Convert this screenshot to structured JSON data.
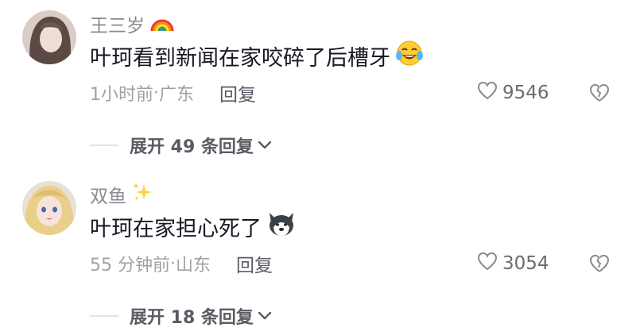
{
  "comments": [
    {
      "username": "王三岁",
      "badge_icon": "rainbow-emoji",
      "text": "叶珂看到新闻在家咬碎了后槽牙",
      "emoji_icon": "crying-laughing-emoji",
      "time": "1小时前",
      "location": "广东",
      "reply_label": "回复",
      "likes": "9546",
      "expand_label": "展开 49 条回复"
    },
    {
      "username": "双鱼",
      "badge_icon": "sparkles-emoji",
      "text": "叶珂在家担心死了",
      "emoji_icon": "husky-dog-emoji",
      "time": "55 分钟前",
      "location": "山东",
      "reply_label": "回复",
      "likes": "3054",
      "expand_label": "展开 18 条回复"
    }
  ],
  "colors": {
    "username": "#8a8b91",
    "content": "#161823",
    "meta": "#a0a1a6",
    "action": "#5a5b63"
  }
}
